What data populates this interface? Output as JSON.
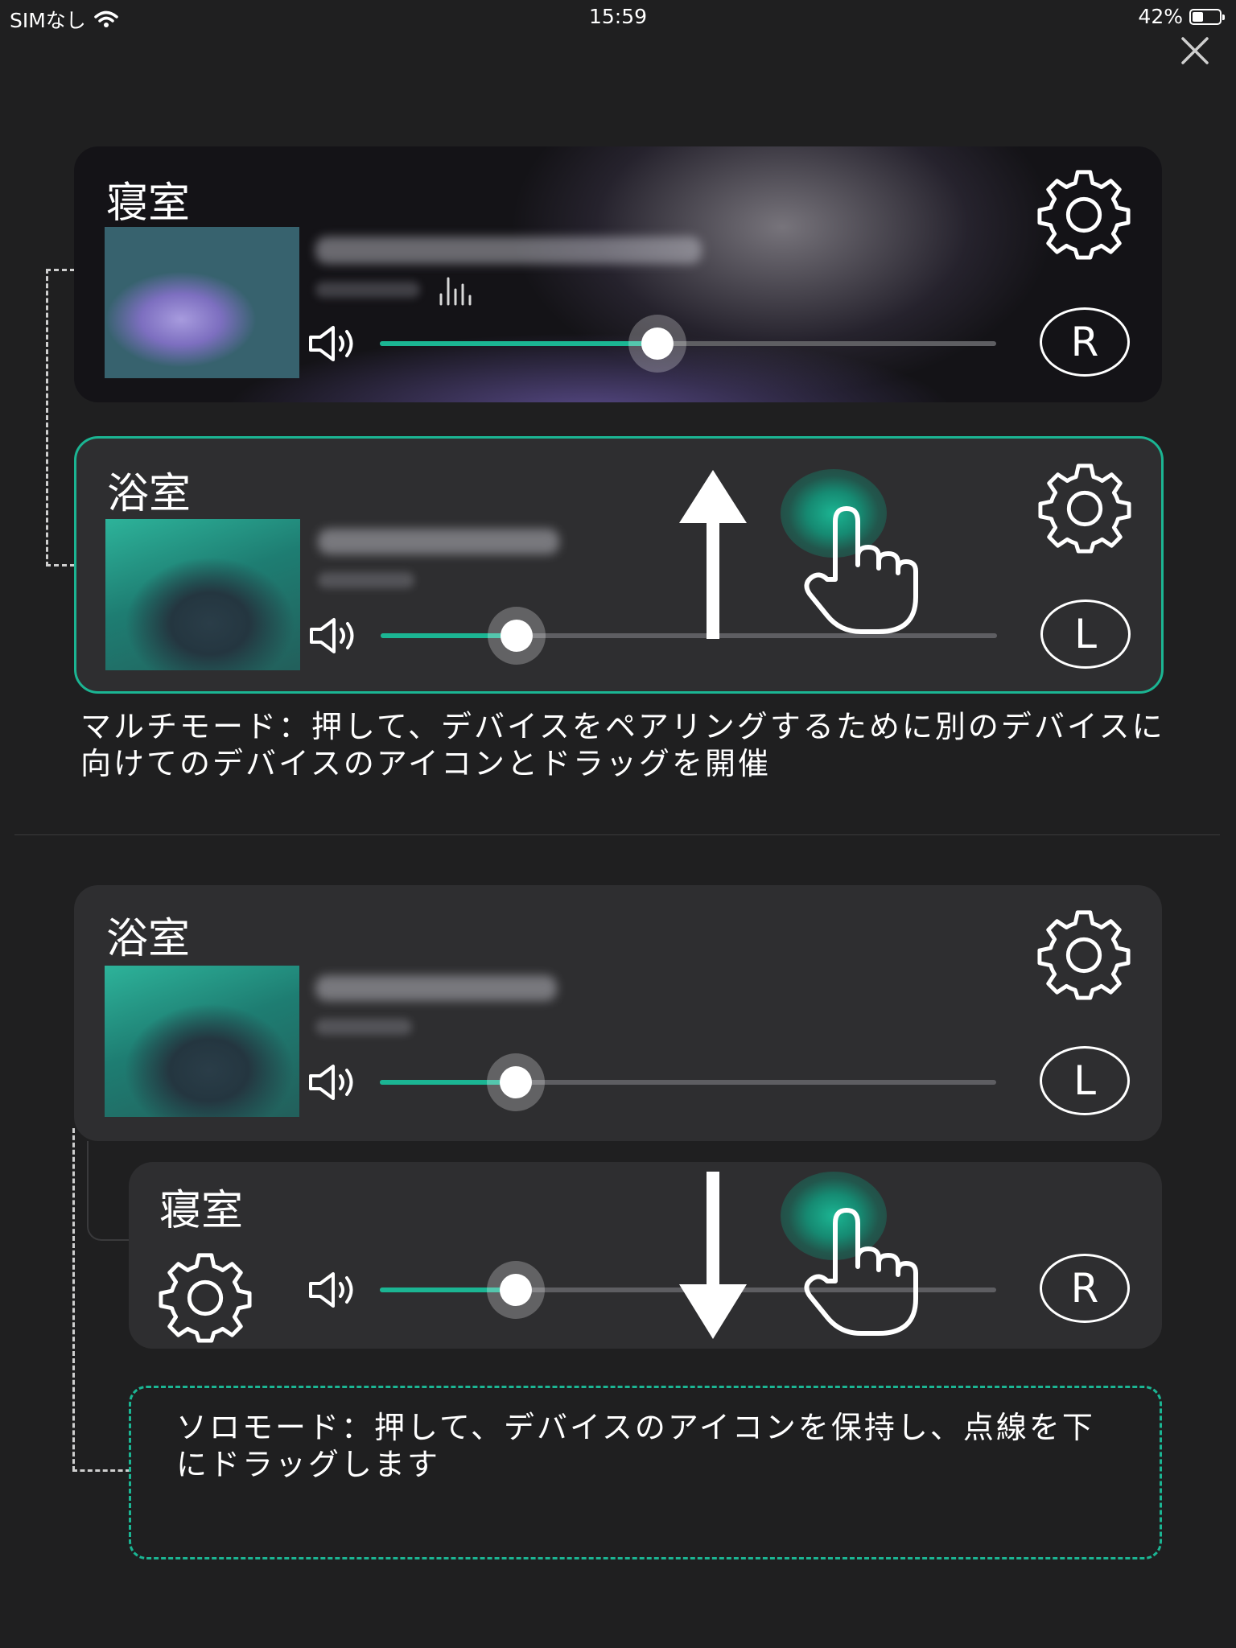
{
  "status_bar": {
    "carrier": "SIMなし",
    "time": "15:59",
    "battery_percent_text": "42%",
    "battery_level": 0.42,
    "icons": [
      "wifi-icon",
      "battery-icon"
    ]
  },
  "close_icon": "close-icon",
  "colors": {
    "background": "#1f1f20",
    "card": "#2e2e30",
    "accent": "#1bb593",
    "track": "#5e5e62"
  },
  "multi_mode": {
    "card_bedroom": {
      "room": "寝室",
      "channel": "R",
      "volume_fraction": 0.45,
      "icons": [
        "gear-icon",
        "speaker-icon",
        "equalizer-icon"
      ]
    },
    "card_bathroom": {
      "room": "浴室",
      "channel": "L",
      "volume_fraction": 0.22,
      "icons": [
        "gear-icon",
        "speaker-icon",
        "arrow-up-icon",
        "hand-pointer-icon"
      ]
    },
    "hint": "マルチモード：押して、デバイスをペアリングするために別のデバイスに向けてのデバイスのアイコンとドラッグを開催"
  },
  "solo_mode": {
    "card_bathroom": {
      "room": "浴室",
      "channel": "L",
      "volume_fraction": 0.22
    },
    "card_bedroom": {
      "room": "寝室",
      "channel": "R",
      "volume_fraction": 0.22,
      "icons": [
        "gear-icon",
        "speaker-icon",
        "arrow-down-icon",
        "hand-pointer-icon"
      ]
    },
    "hint": "ソロモード：押して、デバイスのアイコンを保持し、点線を下にドラッグします"
  }
}
